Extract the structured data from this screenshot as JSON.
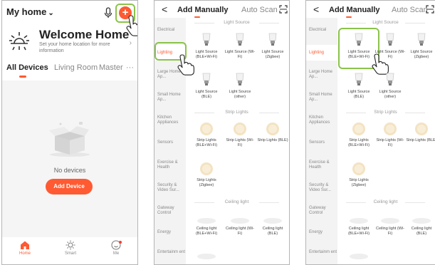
{
  "home": {
    "title": "My home",
    "welcome_title": "Welcome Home",
    "welcome_sub": "Set your home location for more information",
    "tabs": [
      "All Devices",
      "Living Room",
      "Master",
      "···"
    ],
    "empty_text": "No devices",
    "add_device_label": "Add Device",
    "nav": [
      "Home",
      "Smart",
      "Me"
    ]
  },
  "add_manually": {
    "back": "<",
    "tab_manual": "Add Manually",
    "tab_auto": "Auto Scan",
    "categories": [
      "Electrical",
      "Lighting",
      "Large Home Ap...",
      "Small Home Ap...",
      "Kitchen Appliances",
      "Sensors",
      "Exercise & Health",
      "Security & Video Sur...",
      "Gateway Control",
      "Energy",
      "Entertainm ent"
    ],
    "sections": {
      "light_source": "Light Source",
      "strip_lights": "Strip Lights",
      "ceiling_light": "Ceiling light"
    },
    "light_sources": [
      "Light Source (BLE+Wi-Fi)",
      "Light Source (Wi-Fi)",
      "Light Source (Zigbee)",
      "Light Source (BLE)",
      "Light Source (other)"
    ],
    "strip_lights": [
      "Strip Lights (BLE+Wi-Fi)",
      "Strip Lights (Wi-Fi)",
      "Strip Lights (BLE)",
      "Strip Lights (Zigbee)"
    ],
    "ceiling_lights": [
      "Ceiling light (BLE+Wi-Fi)",
      "Ceiling light (Wi-Fi)",
      "Ceiling light (BLE)"
    ]
  },
  "colors": {
    "accent": "#ff5a32",
    "highlight": "#8bc34a"
  },
  "icons": [
    "mic-icon",
    "add-icon",
    "sun-icon",
    "chevron-right-icon",
    "empty-box-icon",
    "home-icon",
    "smart-icon",
    "me-icon",
    "back-icon",
    "scan-icon",
    "bulb-icon",
    "strip-light-icon",
    "ceiling-light-icon",
    "hand-pointer-icon"
  ]
}
